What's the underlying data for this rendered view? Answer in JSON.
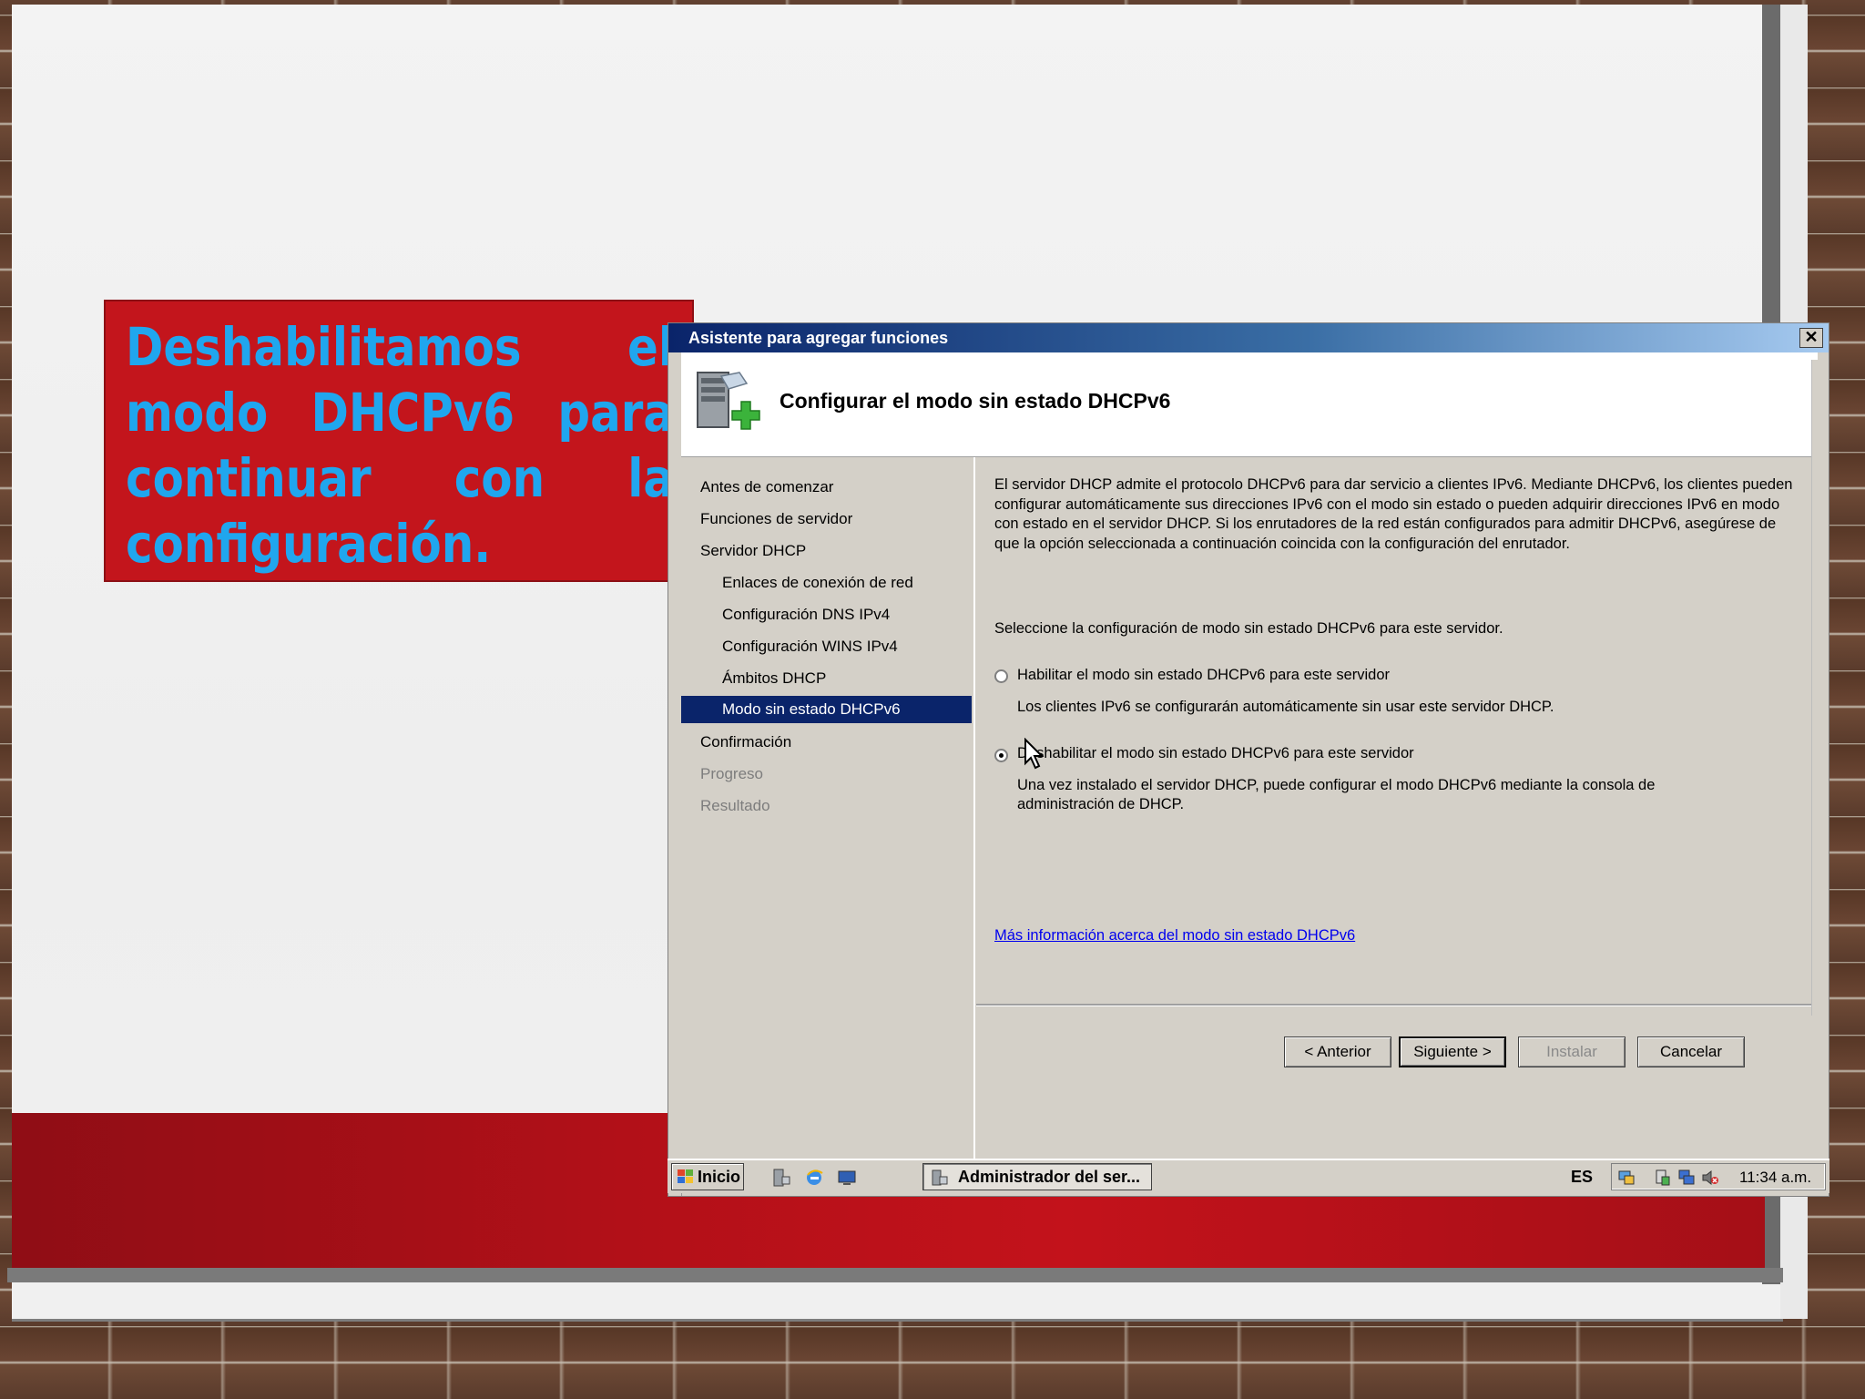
{
  "slide": {
    "callout_text": "Deshabilitamos el modo DHCPv6 para continuar con la configuración."
  },
  "window": {
    "title": "Asistente para agregar funciones",
    "close_label": "✕",
    "header_title": "Configurar el modo sin estado DHCPv6",
    "header_icon": "server-add-icon",
    "nav": {
      "items": [
        "Antes de comenzar",
        "Funciones de servidor",
        "Servidor DHCP",
        "Enlaces de conexión de red",
        "Configuración DNS IPv4",
        "Configuración WINS IPv4",
        "Ámbitos DHCP",
        "Modo sin estado DHCPv6",
        "Confirmación",
        "Progreso",
        "Resultado"
      ],
      "selected": "Modo sin estado DHCPv6"
    },
    "content": {
      "description": "El servidor DHCP admite el protocolo DHCPv6 para dar servicio a clientes IPv6. Mediante DHCPv6, los clientes pueden configurar automáticamente sus direcciones IPv6 con el modo sin estado o pueden adquirir direcciones IPv6 en modo con estado en el servidor DHCP. Si los enrutadores de la red están configurados para admitir DHCPv6, asegúrese de que la opción seleccionada a continuación coincida con la configuración del enrutador.",
      "select_label": "Seleccione la configuración de modo sin estado DHCPv6 para este servidor.",
      "option_enable": {
        "label": "Habilitar el modo sin estado DHCPv6 para este servidor",
        "description": "Los clientes IPv6 se configurarán automáticamente sin usar este servidor DHCP.",
        "checked": false
      },
      "option_disable": {
        "label": "Deshabilitar el modo sin estado DHCPv6 para este servidor",
        "description": "Una vez instalado el servidor DHCP, puede configurar el modo DHCPv6 mediante la consola de administración de DHCP.",
        "checked": true
      },
      "more_info_link": "Más información acerca del modo sin estado DHCPv6"
    },
    "buttons": {
      "back": "< Anterior",
      "next": "Siguiente >",
      "install": "Instalar",
      "cancel": "Cancelar"
    }
  },
  "taskbar": {
    "start_label": "Inicio",
    "quick_launch": [
      "server-manager-icon",
      "internet-explorer-icon",
      "show-desktop-icon"
    ],
    "task_button": "Administrador del ser...",
    "language": "ES",
    "clock": "11:34 a.m.",
    "tray_icons": [
      "network-icon",
      "security-icon",
      "display-icon",
      "volume-muted-icon"
    ]
  }
}
